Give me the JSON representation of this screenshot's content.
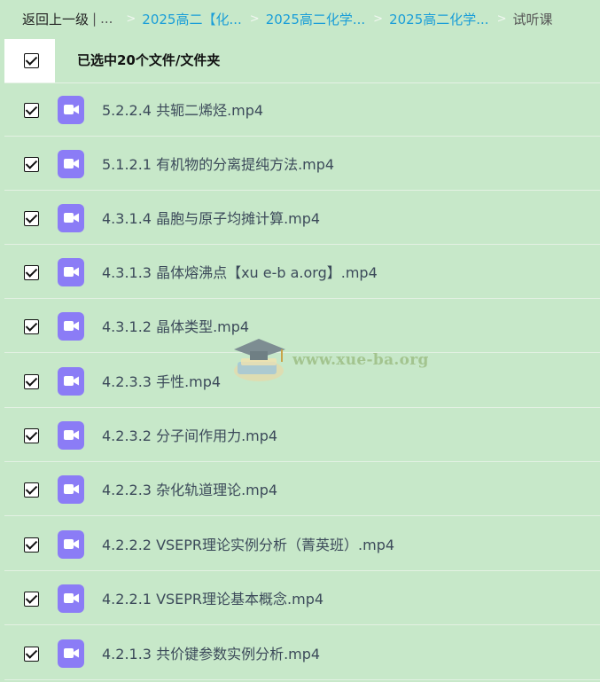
{
  "breadcrumb": {
    "back_label": "返回上一级",
    "separator": "|",
    "ellipsis": "...",
    "items": [
      {
        "label": "2025高二【化..."
      },
      {
        "label": "2025高二化学..."
      },
      {
        "label": "2025高二化学..."
      }
    ],
    "current": "试听课"
  },
  "selection": {
    "label": "已选中20个文件/文件夹",
    "checked": true
  },
  "files": [
    {
      "name": "5.2.2.4 共轭二烯烃.mp4",
      "icon": "video-file-icon"
    },
    {
      "name": "5.1.2.1 有机物的分离提纯方法.mp4",
      "icon": "video-file-icon"
    },
    {
      "name": "4.3.1.4 晶胞与原子均摊计算.mp4",
      "icon": "video-file-icon"
    },
    {
      "name": "4.3.1.3 晶体熔沸点【xu e-b a.org】.mp4",
      "icon": "video-file-icon"
    },
    {
      "name": "4.3.1.2 晶体类型.mp4",
      "icon": "video-file-icon"
    },
    {
      "name": "4.2.3.3 手性.mp4",
      "icon": "video-file-icon"
    },
    {
      "name": "4.2.3.2 分子间作用力.mp4",
      "icon": "video-file-icon"
    },
    {
      "name": "4.2.2.3 杂化轨道理论.mp4",
      "icon": "video-file-icon"
    },
    {
      "name": "4.2.2.2 VSEPR理论实例分析（菁英班）.mp4",
      "icon": "video-file-icon"
    },
    {
      "name": "4.2.2.1 VSEPR理论基本概念.mp4",
      "icon": "video-file-icon"
    },
    {
      "name": "4.2.1.3 共价键参数实例分析.mp4",
      "icon": "video-file-icon"
    }
  ],
  "watermark": {
    "text": "www.xue-ba.org"
  },
  "colors": {
    "background": "#c7e8c9",
    "link": "#1a9ed8",
    "file_icon": "#8b7cf6"
  }
}
